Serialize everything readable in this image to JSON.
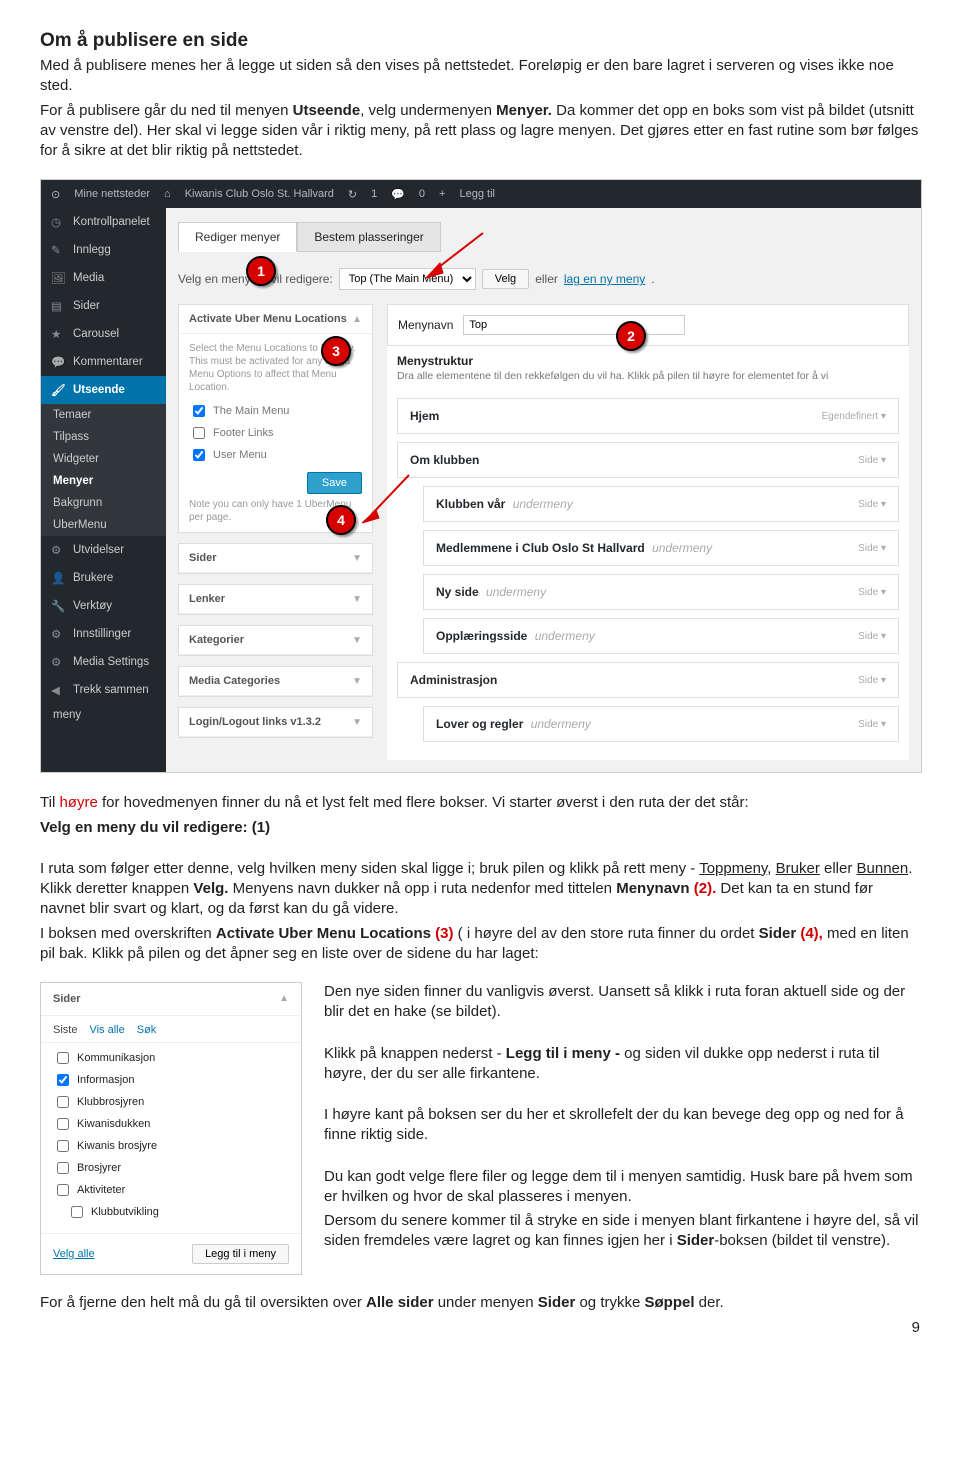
{
  "doc": {
    "title": "Om å publisere en side",
    "intro1": "Med å publisere menes her å legge ut siden så den vises på nettstedet. Foreløpig er den bare lagret i serveren og vises ikke noe sted.",
    "intro2a": "For å publisere går du ned til menyen ",
    "intro2b": "Utseende",
    "intro2c": ", velg undermenyen ",
    "intro2d": "Menyer.",
    "intro2e": " Da kommer det opp en boks som vist på bildet (utsnitt av venstre del). Her skal vi legge siden vår i riktig meny, på rett plass og lagre menyen. Det gjøres etter en fast rutine som bør følges for å sikre at det blir riktig på nettstedet.",
    "mid1a": "Til ",
    "mid1b": "høyre",
    "mid1c": " for hovedmenyen finner du nå et lyst felt med flere bokser. Vi starter øverst i den ruta der det står:",
    "mid2": "Velg en meny du vil redigere: (1)",
    "mid3a": "I ruta som følger etter denne, velg hvilken meny siden skal ligge i; bruk pilen og klikk på rett meny - ",
    "mid3b": "Toppmeny",
    "mid3c": ", ",
    "mid3d": "Bruker",
    "mid3e": " eller ",
    "mid3f": "Bunnen",
    "mid3g": ". Klikk deretter knappen ",
    "mid3h": "Velg.",
    "mid3i": " Menyens navn dukker nå opp i ruta nedenfor med tittelen ",
    "mid3j": "Menynavn ",
    "mid3k": "(2).",
    "mid3l": " Det kan ta en stund før navnet blir svart og klart, og da først kan du gå videre.",
    "mid4a": "I boksen med overskriften ",
    "mid4b": "Activate Uber Menu Locations ",
    "mid4c": "(3)",
    "mid4d": " ( i høyre del av den store ruta finner du ordet ",
    "mid4e": "Sider ",
    "mid4f": "(4),",
    "mid4g": " med en liten pil bak. Klikk på pilen og det åpner seg en liste over de sidene du har laget:",
    "right1": "Den nye siden finner du vanligvis øverst. Uansett så klikk i ruta foran aktuell side og der blir det en hake (se bildet).",
    "right2a": "Klikk på knappen nederst - ",
    "right2b": "Legg til i meny - ",
    "right2c": "og siden vil dukke opp nederst i ruta til høyre, der du ser alle firkantene.",
    "right3": "I høyre kant på boksen ser du her et skrollefelt der du kan bevege deg opp og ned for å finne riktig side.",
    "right4": "Du kan godt velge flere filer og legge dem til i menyen samtidig. Husk bare på hvem som er hvilken og hvor de skal plasseres i menyen.",
    "right5a": "Dersom du senere kommer til å stryke en side i menyen blant firkantene i høyre del, så vil siden fremdeles være lagret og kan finnes igjen her i ",
    "right5b": "Sider",
    "right5c": "-boksen (bildet til venstre).",
    "bottom1a": "For å fjerne den helt må du gå til oversikten over ",
    "bottom1b": "Alle sider",
    "bottom1c": " under  menyen ",
    "bottom1d": "Sider",
    "bottom1e": " og trykke ",
    "bottom1f": "Søppel",
    "bottom1g": " der.",
    "page": "9"
  },
  "shot": {
    "bar": {
      "mysites": "Mine nettsteder",
      "site": "Kiwanis Club Oslo St. Hallvard",
      "updates": "1",
      "comments": "0",
      "new": "Legg til"
    },
    "side": {
      "dashboard": "Kontrollpanelet",
      "posts": "Innlegg",
      "media": "Media",
      "pages": "Sider",
      "carousel": "Carousel",
      "comments": "Kommentarer",
      "appearance": "Utseende",
      "themes": "Temaer",
      "customize": "Tilpass",
      "widgets": "Widgeter",
      "menus": "Menyer",
      "background": "Bakgrunn",
      "ubermenu": "UberMenu",
      "plugins": "Utvidelser",
      "users": "Brukere",
      "tools": "Verktøy",
      "settings": "Innstillinger",
      "mediasettings": "Media Settings",
      "collapse": "Trekk sammen",
      "meny": "meny"
    },
    "tabs": {
      "edit": "Rediger menyer",
      "locations": "Bestem plasseringer"
    },
    "select": {
      "label": "Velg en meny du vil redigere:",
      "value": "Top (The Main Menu)",
      "btn": "Velg",
      "or": "eller",
      "create": "lag en ny meny"
    },
    "uber": {
      "head": "Activate Uber Menu Locations",
      "note": "Select the Menu Locations to Megafy. This must be activated for any Mega Menu Options to affect that Menu Location.",
      "c1": "The Main Menu",
      "c2": "Footer Links",
      "c3": "User Menu",
      "save": "Save",
      "ft": "Note you can only have 1 UberMenu per page."
    },
    "accl": {
      "sider": "Sider",
      "lenker": "Lenker",
      "kat": "Kategorier",
      "mc": "Media Categories",
      "ll": "Login/Logout links v1.3.2"
    },
    "right": {
      "menyname_l": "Menynavn",
      "menyname_v": "Top",
      "struct": "Menystruktur",
      "struct_sub": "Dra alle elementene til den rekkefølgen du vil ha. Klikk på pilen til høyre for elementet for å vi",
      "undermeny": "undermeny",
      "side": "Side",
      "egendef": "Egendefinert",
      "i1": "Hjem",
      "i2": "Om klubben",
      "i3a": "Klubben vår",
      "i4a": "Medlemmene i Club Oslo St Hallvard",
      "i5a": "Ny side",
      "i6a": "Opplæringsside",
      "i7": "Administrasjon",
      "i8a": "Lover og regler"
    }
  },
  "mini": {
    "head": "Sider",
    "t1": "Siste",
    "t2": "Vis alle",
    "t3": "Søk",
    "i1": "Kommunikasjon",
    "i2": "Informasjon",
    "i3": "Klubbrosjyren",
    "i4": "Kiwanisdukken",
    "i5": "Kiwanis brosjyre",
    "i6": "Brosjyrer",
    "i7": "Aktiviteter",
    "i8": "Klubbutvikling",
    "selall": "Velg alle",
    "add": "Legg til i meny"
  }
}
